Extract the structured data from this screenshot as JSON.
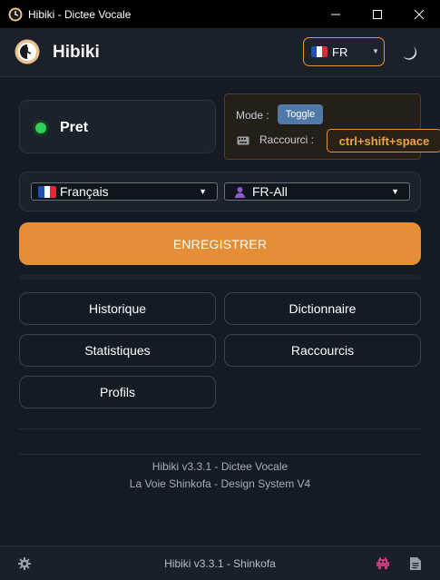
{
  "window": {
    "title": "Hibiki - Dictee Vocale"
  },
  "header": {
    "app_name": "Hibiki",
    "language_code": "FR"
  },
  "status": {
    "label": "Pret",
    "indicator_color": "#2fce5a"
  },
  "mode": {
    "mode_label": "Mode :",
    "mode_value": "Toggle",
    "shortcut_label": "Raccourci :",
    "shortcut_value": "ctrl+shift+space"
  },
  "selects": {
    "language": "Français",
    "profile": "FR-All"
  },
  "record_button": {
    "label": "ENREGISTRER",
    "color": "#e48f38"
  },
  "nav": {
    "history": "Historique",
    "dictionary": "Dictionnaire",
    "statistics": "Statistiques",
    "shortcuts": "Raccourcis",
    "profiles": "Profils"
  },
  "footer": {
    "line1": "Hibiki v3.3.1 - Dictee Vocale",
    "line2": "La Voie Shinkofa - Design System V4"
  },
  "statusbar": {
    "version": "Hibiki v3.3.1 - Shinkofa"
  },
  "icons": {
    "app": "clock-logo-icon",
    "theme": "moon-icon",
    "settings": "gear-icon",
    "alien": "alien-icon",
    "document": "document-icon"
  },
  "colors": {
    "accent": "#e8913a",
    "background": "#151b24"
  }
}
